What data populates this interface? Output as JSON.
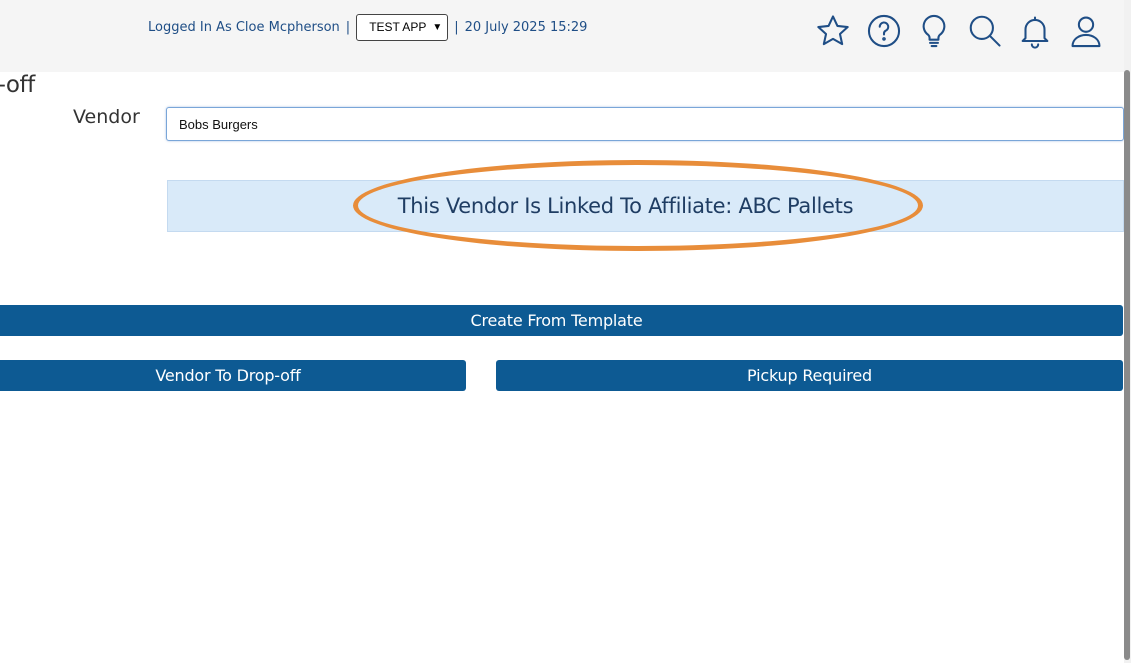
{
  "header": {
    "logged_in_text": "Logged In As Cloe Mcpherson",
    "separator": "|",
    "app_selector": {
      "selected": "TEST APP"
    },
    "datetime": "20 July 2025 15:29",
    "icons": [
      "star-icon",
      "help-icon",
      "lightbulb-icon",
      "search-icon",
      "bell-icon",
      "user-icon"
    ]
  },
  "form": {
    "section_title": "op-off",
    "vendor_label": "Vendor",
    "vendor_value": "Bobs Burgers",
    "info_message": "This Vendor Is Linked To Affiliate: ABC Pallets"
  },
  "buttons": {
    "create_template": "Create From Template",
    "vendor_dropoff": "Vendor To Drop-off",
    "pickup_required": "Pickup Required"
  },
  "colors": {
    "accent": "#0d5a93",
    "link_text": "#1f4e86",
    "info_bg": "#d9eaf9",
    "highlight": "#e88d3a"
  }
}
